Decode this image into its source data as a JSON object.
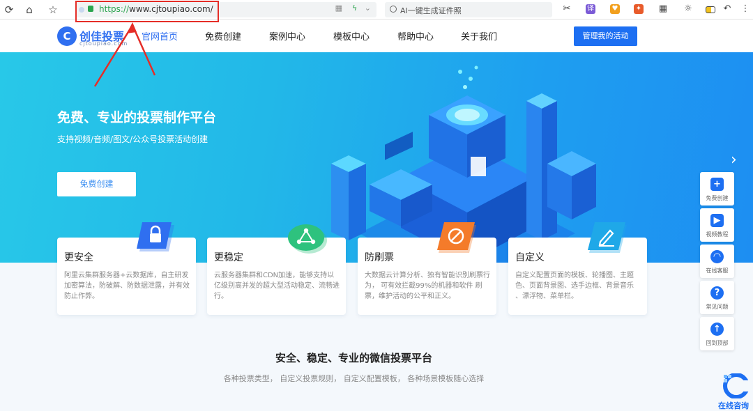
{
  "browser": {
    "url_scheme": "https://",
    "url_rest": "www.cjtoupiao.com/",
    "search_placeholder": "AI一键生成证件照"
  },
  "site": {
    "logo_name": "创佳投票",
    "logo_domain": "cjtoupiao.com",
    "menu": [
      "官网首页",
      "免费创建",
      "案例中心",
      "模板中心",
      "帮助中心",
      "关于我们"
    ],
    "manage_label": "管理我的活动"
  },
  "hero": {
    "title": "免费、专业的投票制作平台",
    "subtitle": "支持视频/音频/图文/公众号投票活动创建",
    "cta": "免费创建"
  },
  "features": [
    {
      "title": "更安全",
      "desc": "阿里云集群服务器+云数据库，自主研发加密算法，防破解、防数据泄露，并有效防止作弊。",
      "color": "#2f6ff0"
    },
    {
      "title": "更稳定",
      "desc": "云服务器集群和CDN加速，能够支持以亿级别高并发的超大型活动稳定、流畅进行。",
      "color": "#2ec27e"
    },
    {
      "title": "防刷票",
      "desc": "大数据云计算分析、独有智能识别刷票行为， 可有效拦截99%的机器和软件 刷票，维护活动的公平和正义。",
      "color": "#f47b2a"
    },
    {
      "title": "自定义",
      "desc": "自定义配置页面的模板、轮播图、主题色、页面背景图、选手边框、背景音乐 、漂浮物、菜单栏。",
      "color": "#1fa8e8"
    }
  ],
  "section": {
    "title": "安全、稳定、专业的微信投票平台",
    "subtitle": "各种投票类型， 自定义投票规则， 自定义配置模板， 各种场景模板随心选择"
  },
  "float_bar": [
    {
      "label": "免费创建",
      "icon": "plus-icon"
    },
    {
      "label": "视频教程",
      "icon": "video-icon"
    },
    {
      "label": "在线客服",
      "icon": "headset-icon"
    },
    {
      "label": "常见问题",
      "icon": "question-icon"
    },
    {
      "label": "回到顶部",
      "icon": "arrow-up-icon"
    }
  ],
  "chat_label": "在线咨询",
  "colors": {
    "brand": "#1d6ff2",
    "highlight": "#e52d27"
  }
}
